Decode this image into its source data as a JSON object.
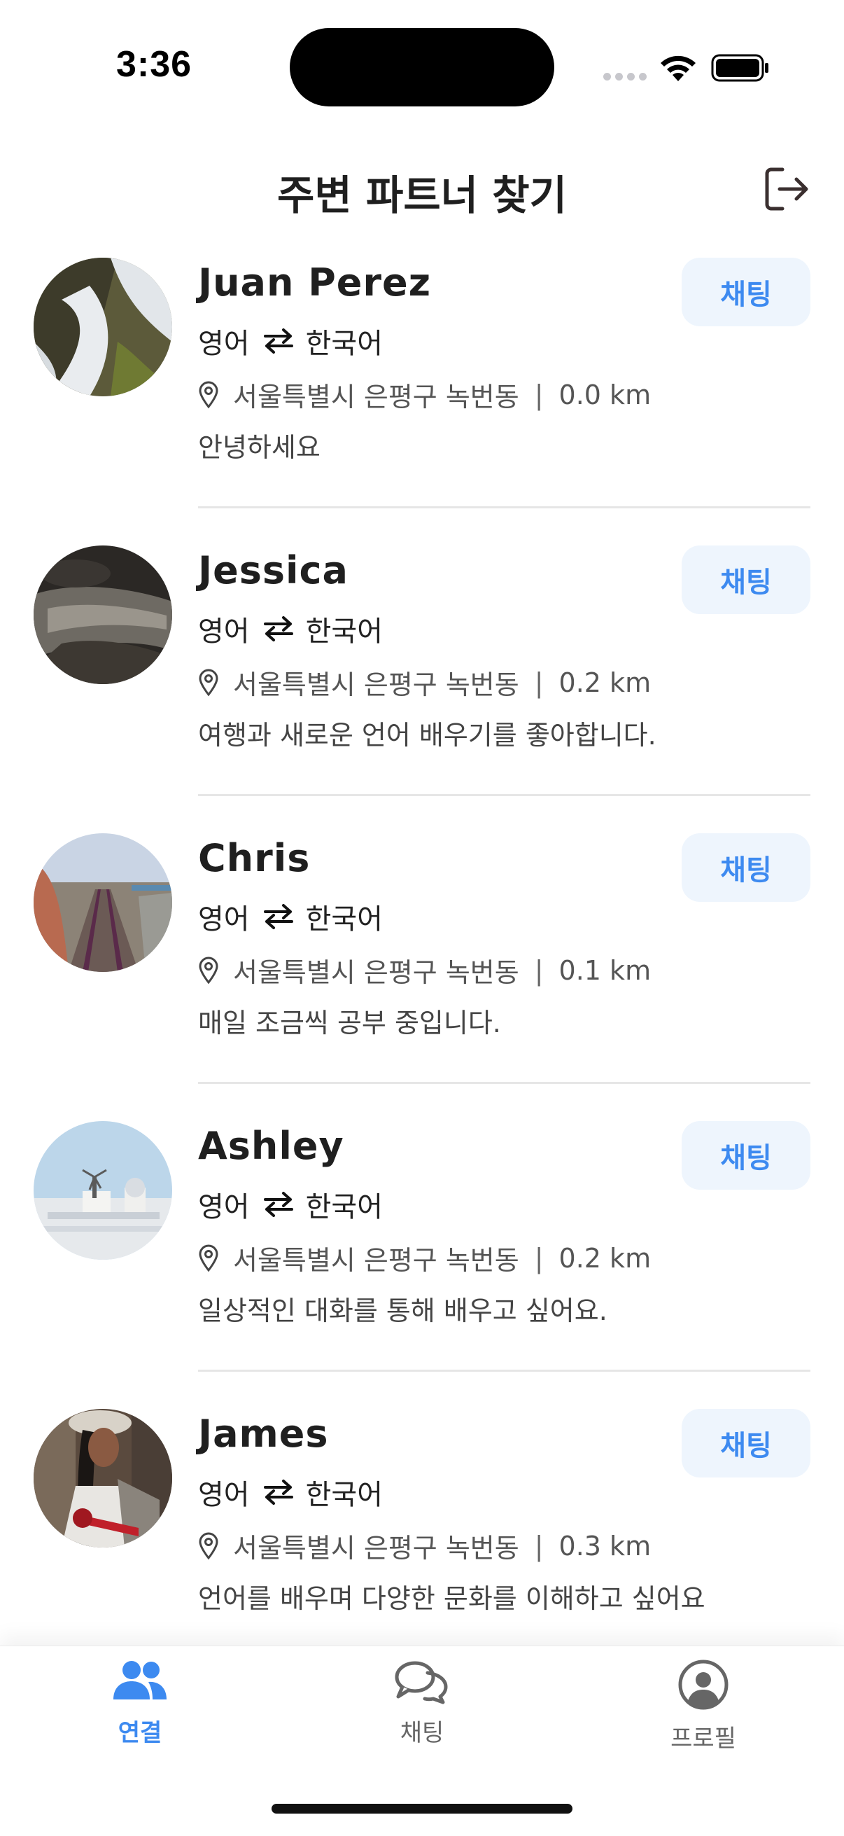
{
  "status_bar": {
    "time": "3:36"
  },
  "header": {
    "title": "주변 파트너 찾기",
    "logout_icon": "logout-icon"
  },
  "partners": [
    {
      "name": "Juan Perez",
      "native": "영어",
      "learning": "한국어",
      "location": "서울특별시 은평구 녹번동",
      "distance": "0.0 km",
      "bio": "안녕하세요",
      "chat_label": "채팅"
    },
    {
      "name": "Jessica",
      "native": "영어",
      "learning": "한국어",
      "location": "서울특별시 은평구 녹번동",
      "distance": "0.2 km",
      "bio": "여행과 새로운 언어 배우기를 좋아합니다.",
      "chat_label": "채팅"
    },
    {
      "name": "Chris",
      "native": "영어",
      "learning": "한국어",
      "location": "서울특별시 은평구 녹번동",
      "distance": "0.1 km",
      "bio": "매일 조금씩 공부 중입니다.",
      "chat_label": "채팅"
    },
    {
      "name": "Ashley",
      "native": "영어",
      "learning": "한국어",
      "location": "서울특별시 은평구 녹번동",
      "distance": "0.2 km",
      "bio": "일상적인 대화를 통해 배우고 싶어요.",
      "chat_label": "채팅"
    },
    {
      "name": "James",
      "native": "영어",
      "learning": "한국어",
      "location": "서울특별시 은평구 녹번동",
      "distance": "0.3 km",
      "bio": "언어를 배우며 다양한 문화를 이해하고 싶어요",
      "chat_label": "채팅"
    }
  ],
  "tabbar": {
    "tabs": [
      {
        "label": "연결",
        "icon": "people-icon",
        "active": true
      },
      {
        "label": "채팅",
        "icon": "chat-bubbles-icon",
        "active": false
      },
      {
        "label": "프로필",
        "icon": "profile-icon",
        "active": false
      }
    ]
  },
  "colors": {
    "accent": "#3d8af0",
    "chat_button_bg": "#eef5fd",
    "divider": "#e6e6e6"
  }
}
